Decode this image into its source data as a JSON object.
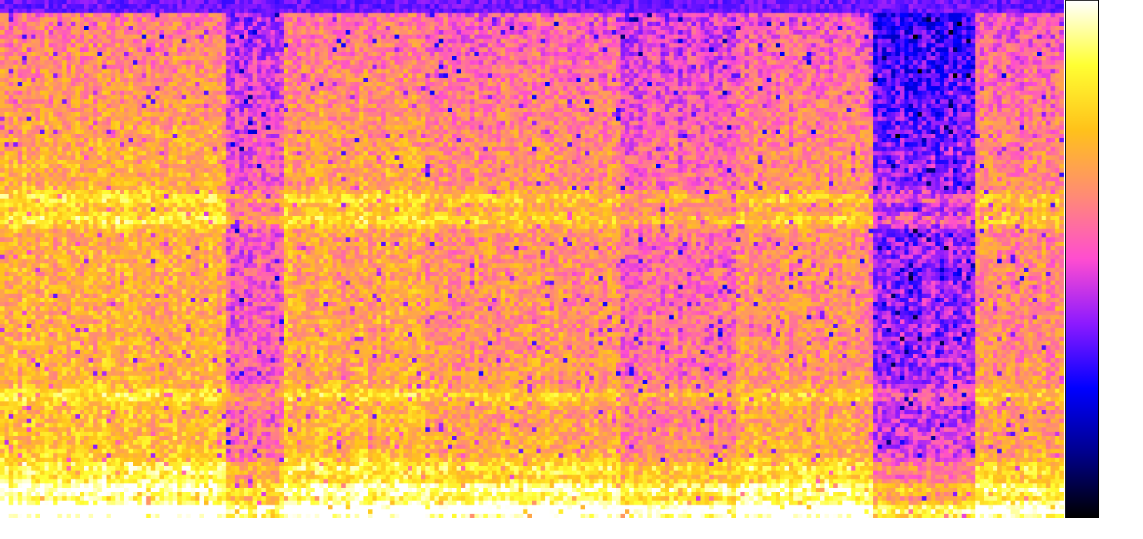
{
  "chart_data": {
    "type": "heatmap",
    "title": "",
    "xlabel": "",
    "ylabel": "",
    "colormap": "gnuplot2",
    "colorbar_stops": [
      "#000000",
      "#00008c",
      "#0000ff",
      "#8c1aff",
      "#ff4dd0",
      "#ff8c73",
      "#ffc21a",
      "#ffff33",
      "#ffffff"
    ],
    "grid": false,
    "legend": "none",
    "colorbar_position": "right",
    "time_bins": 240,
    "frequency_bins": 120,
    "segments": [
      {
        "name": "segment-1",
        "start": 0.0,
        "end": 0.21,
        "level": 0.7,
        "low_band": 0.88
      },
      {
        "name": "segment-2",
        "start": 0.21,
        "end": 0.265,
        "level": 0.52,
        "low_band": 0.72
      },
      {
        "name": "segment-3",
        "start": 0.265,
        "end": 0.4,
        "level": 0.68,
        "low_band": 0.86
      },
      {
        "name": "segment-4",
        "start": 0.4,
        "end": 0.58,
        "level": 0.64,
        "low_band": 0.84
      },
      {
        "name": "segment-5",
        "start": 0.58,
        "end": 0.69,
        "level": 0.56,
        "low_band": 0.8
      },
      {
        "name": "segment-6",
        "start": 0.69,
        "end": 0.82,
        "level": 0.63,
        "low_band": 0.86
      },
      {
        "name": "segment-7",
        "start": 0.82,
        "end": 0.915,
        "level": 0.38,
        "low_band": 0.66
      },
      {
        "name": "segment-8",
        "start": 0.915,
        "end": 1.0,
        "level": 0.62,
        "low_band": 0.8
      }
    ],
    "harmonic_bands": [
      {
        "freq": 0.02,
        "strength": 0.3
      },
      {
        "freq": 0.06,
        "strength": 0.2
      },
      {
        "freq": 0.1,
        "strength": 0.12
      },
      {
        "freq": 0.24,
        "strength": 0.12
      },
      {
        "freq": 0.58,
        "strength": 0.16
      },
      {
        "freq": 0.62,
        "strength": 0.14
      }
    ]
  }
}
